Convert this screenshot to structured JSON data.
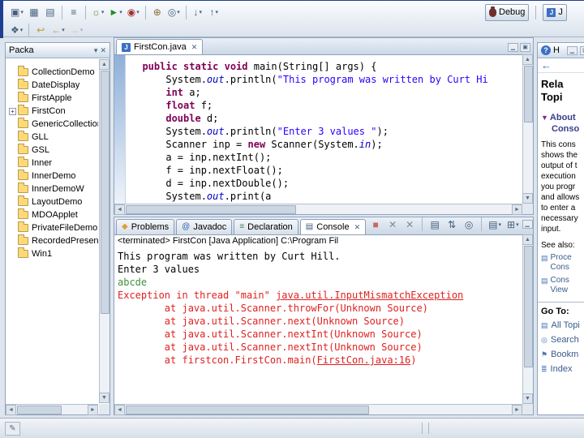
{
  "perspective": {
    "debug_label": "Debug",
    "java_label": "J"
  },
  "toolbar_row1": [
    {
      "name": "new-wizard-button",
      "glyph": "▣",
      "dd": true
    },
    {
      "name": "save-button",
      "glyph": "▦"
    },
    {
      "name": "print-button",
      "glyph": "▤"
    },
    {
      "name": "sep"
    },
    {
      "name": "open-type-button",
      "glyph": "≡"
    },
    {
      "name": "sep"
    },
    {
      "name": "debug-button",
      "glyph": "☼",
      "dd": true,
      "color": "#5a7a3a"
    },
    {
      "name": "run-button",
      "glyph": "►",
      "dd": true,
      "color": "#1f8f1f"
    },
    {
      "name": "external-tools-button",
      "glyph": "◉",
      "dd": true,
      "color": "#a03030"
    },
    {
      "name": "sep"
    },
    {
      "name": "create-jar-button",
      "glyph": "⊕",
      "color": "#8a6d3b"
    },
    {
      "name": "search-button",
      "glyph": "◎",
      "dd": true
    },
    {
      "name": "sep"
    },
    {
      "name": "next-annotation-button",
      "glyph": "↓",
      "dd": true
    },
    {
      "name": "previous-annotation-button",
      "glyph": "↑",
      "dd": true
    }
  ],
  "toolbar_row2": [
    {
      "name": "open-perspective-button",
      "glyph": "❖",
      "dd": true
    },
    {
      "name": "sep"
    },
    {
      "name": "last-edit-location-button",
      "glyph": "↩",
      "color": "#c09a30"
    },
    {
      "name": "back-button",
      "glyph": "←",
      "dd": true,
      "color": "#c09a30"
    },
    {
      "name": "forward-button",
      "glyph": "→",
      "dd": true,
      "color": "#c09a30",
      "disabled": true
    }
  ],
  "explorer": {
    "title": "Packa",
    "items": [
      {
        "label": "CollectionDemo"
      },
      {
        "label": "DateDisplay"
      },
      {
        "label": "FirstApple"
      },
      {
        "label": "FirstCon",
        "expand": true
      },
      {
        "label": "GenericCollectionD"
      },
      {
        "label": "GLL"
      },
      {
        "label": "GSL"
      },
      {
        "label": "Inner"
      },
      {
        "label": "InnerDemo"
      },
      {
        "label": "InnerDemoW"
      },
      {
        "label": "LayoutDemo"
      },
      {
        "label": "MDOApplet"
      },
      {
        "label": "PrivateFileDemo"
      },
      {
        "label": "RecordedPresenta"
      },
      {
        "label": "Win1"
      }
    ]
  },
  "editor": {
    "tab_label": "FirstCon.java",
    "lines": [
      [
        {
          "c": "k",
          "t": "  public static void "
        },
        {
          "c": "p",
          "t": "main(String[] args) {"
        }
      ],
      [
        {
          "c": "p",
          "t": "      System."
        },
        {
          "c": "f",
          "t": "out"
        },
        {
          "c": "p",
          "t": ".println("
        },
        {
          "c": "s",
          "t": "\"This program was written by Curt Hi"
        }
      ],
      [
        {
          "c": "k",
          "t": "      int"
        },
        {
          "c": "p",
          "t": " a;"
        }
      ],
      [
        {
          "c": "k",
          "t": "      float"
        },
        {
          "c": "p",
          "t": " f;"
        }
      ],
      [
        {
          "c": "k",
          "t": "      double"
        },
        {
          "c": "p",
          "t": " d;"
        }
      ],
      [
        {
          "c": "p",
          "t": "      System."
        },
        {
          "c": "f",
          "t": "out"
        },
        {
          "c": "p",
          "t": ".println("
        },
        {
          "c": "s",
          "t": "\"Enter 3 values \""
        },
        {
          "c": "p",
          "t": ");"
        }
      ],
      [
        {
          "c": "p",
          "t": "      Scanner inp = "
        },
        {
          "c": "k",
          "t": "new"
        },
        {
          "c": "p",
          "t": " Scanner(System."
        },
        {
          "c": "f",
          "t": "in"
        },
        {
          "c": "p",
          "t": ");"
        }
      ],
      [
        {
          "c": "p",
          "t": "      a = inp.nextInt();"
        }
      ],
      [
        {
          "c": "p",
          "t": "      f = inp.nextFloat();"
        }
      ],
      [
        {
          "c": "p",
          "t": "      d = inp.nextDouble();"
        }
      ],
      [
        {
          "c": "p",
          "t": "      System."
        },
        {
          "c": "f",
          "t": "out"
        },
        {
          "c": "p",
          "t": ".print(a"
        }
      ]
    ]
  },
  "console": {
    "tabs": [
      {
        "label": "Problems",
        "icon": "problems",
        "glyph": "◆",
        "color": "#d9a03c"
      },
      {
        "label": "Javadoc",
        "icon": "javadoc",
        "glyph": "@",
        "color": "#2a5db0"
      },
      {
        "label": "Declaration",
        "icon": "declaration",
        "glyph": "≡",
        "color": "#3f7f5f"
      },
      {
        "label": "Console",
        "icon": "console",
        "glyph": "▤",
        "color": "#44607e",
        "active": true,
        "closable": true
      }
    ],
    "toolbar": [
      {
        "name": "terminate-button",
        "glyph": "■",
        "color": "#c46a6a"
      },
      {
        "name": "remove-launch-button",
        "glyph": "✕",
        "color": "#7b8da0"
      },
      {
        "name": "remove-all-launches-button",
        "glyph": "✕",
        "color": "#7b8da0"
      },
      {
        "name": "sep"
      },
      {
        "name": "clear-console-button",
        "glyph": "▤"
      },
      {
        "name": "scroll-lock-button",
        "glyph": "⇅"
      },
      {
        "name": "pin-console-button",
        "glyph": "◎"
      },
      {
        "name": "sep"
      },
      {
        "name": "display-selected-console-button",
        "glyph": "▤",
        "dd": true
      },
      {
        "name": "open-console-button",
        "glyph": "⊞",
        "dd": true
      }
    ],
    "status_line": "<terminated> FirstCon [Java Application] C:\\Program Fil",
    "lines": [
      [
        {
          "c": "out",
          "t": "This program was written by Curt Hill."
        }
      ],
      [
        {
          "c": "out",
          "t": "Enter 3 values "
        }
      ],
      [
        {
          "c": "in",
          "t": "abcde"
        }
      ],
      [
        {
          "c": "err",
          "t": "Exception in thread \"main\" "
        },
        {
          "c": "errlink",
          "t": "java.util.InputMismatchException"
        }
      ],
      [
        {
          "c": "err",
          "t": "        at java.util.Scanner.throwFor(Unknown Source)"
        }
      ],
      [
        {
          "c": "err",
          "t": "        at java.util.Scanner.next(Unknown Source)"
        }
      ],
      [
        {
          "c": "err",
          "t": "        at java.util.Scanner.nextInt(Unknown Source)"
        }
      ],
      [
        {
          "c": "err",
          "t": "        at java.util.Scanner.nextInt(Unknown Source)"
        }
      ],
      [
        {
          "c": "err",
          "t": "        at firstcon.FirstCon.main("
        },
        {
          "c": "errlink",
          "t": "FirstCon.java:16"
        },
        {
          "c": "err",
          "t": ")"
        }
      ]
    ]
  },
  "help": {
    "title": "H",
    "heading_lines": [
      "Rela",
      "Topi"
    ],
    "topic_arrow": "▼",
    "topic_label_lines": [
      "About",
      "Conso"
    ],
    "body_lines": [
      "This cons",
      "shows the",
      "output of t",
      "execution",
      "you progr",
      "and allows",
      "to enter a",
      "necessary",
      "input."
    ],
    "see_also_label": "See also:",
    "see_also_links": [
      {
        "glyph": "▤",
        "lines": [
          "Proce",
          "Cons"
        ]
      },
      {
        "glyph": "▤",
        "lines": [
          "Cons",
          "View"
        ]
      }
    ],
    "goto_label": "Go To:",
    "goto_links": [
      {
        "glyph": "▤",
        "label": "All Topi"
      },
      {
        "glyph": "◎",
        "label": "Search"
      },
      {
        "glyph": "⚑",
        "label": "Bookm"
      },
      {
        "glyph": "≣",
        "label": "Index"
      }
    ]
  }
}
